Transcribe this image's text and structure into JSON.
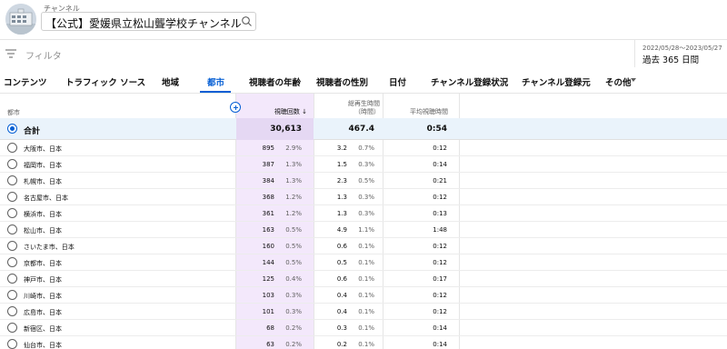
{
  "header": {
    "channel_label": "チャンネル",
    "channel_name": "【公式】愛媛県立松山聾学校チャンネル"
  },
  "filter": {
    "label": "フィルタ"
  },
  "date": {
    "range": "2022/05/28～2023/05/27",
    "period": "過去 365 日間"
  },
  "tabs": [
    {
      "label": "コンテンツ"
    },
    {
      "label": "トラフィック ソース"
    },
    {
      "label": "地域"
    },
    {
      "label": "都市"
    },
    {
      "label": "視聴者の年齢"
    },
    {
      "label": "視聴者の性別"
    },
    {
      "label": "日付"
    },
    {
      "label": "チャンネル登録状況"
    },
    {
      "label": "チャンネル登録元"
    },
    {
      "label": "その他"
    }
  ],
  "active_tab": "都市",
  "colors": {
    "accent": "#065fd4",
    "highlight_column": "#f3e8fb",
    "total_row": "#eaf3fb"
  },
  "table": {
    "headers": {
      "city": "都市",
      "views": "視聴回数 ↓",
      "watch_line1": "総再生時間",
      "watch_line2": "（時間）",
      "avg": "平均視聴時間"
    },
    "total": {
      "label": "合計",
      "views": "30,613",
      "watch": "467.4",
      "avg": "0:54"
    },
    "rows": [
      {
        "name": "大阪市、日本",
        "views": "895",
        "vpct": "2.9%",
        "watch": "3.2",
        "wpct": "0.7%",
        "avg": "0:12"
      },
      {
        "name": "福岡市、日本",
        "views": "387",
        "vpct": "1.3%",
        "watch": "1.5",
        "wpct": "0.3%",
        "avg": "0:14"
      },
      {
        "name": "札幌市、日本",
        "views": "384",
        "vpct": "1.3%",
        "watch": "2.3",
        "wpct": "0.5%",
        "avg": "0:21"
      },
      {
        "name": "名古屋市、日本",
        "views": "368",
        "vpct": "1.2%",
        "watch": "1.3",
        "wpct": "0.3%",
        "avg": "0:12"
      },
      {
        "name": "横浜市、日本",
        "views": "361",
        "vpct": "1.2%",
        "watch": "1.3",
        "wpct": "0.3%",
        "avg": "0:13"
      },
      {
        "name": "松山市、日本",
        "views": "163",
        "vpct": "0.5%",
        "watch": "4.9",
        "wpct": "1.1%",
        "avg": "1:48"
      },
      {
        "name": "さいたま市、日本",
        "views": "160",
        "vpct": "0.5%",
        "watch": "0.6",
        "wpct": "0.1%",
        "avg": "0:12"
      },
      {
        "name": "京都市、日本",
        "views": "144",
        "vpct": "0.5%",
        "watch": "0.5",
        "wpct": "0.1%",
        "avg": "0:12"
      },
      {
        "name": "神戸市、日本",
        "views": "125",
        "vpct": "0.4%",
        "watch": "0.6",
        "wpct": "0.1%",
        "avg": "0:17"
      },
      {
        "name": "川崎市、日本",
        "views": "103",
        "vpct": "0.3%",
        "watch": "0.4",
        "wpct": "0.1%",
        "avg": "0:12"
      },
      {
        "name": "広島市、日本",
        "views": "101",
        "vpct": "0.3%",
        "watch": "0.4",
        "wpct": "0.1%",
        "avg": "0:12"
      },
      {
        "name": "新宿区、日本",
        "views": "68",
        "vpct": "0.2%",
        "watch": "0.3",
        "wpct": "0.1%",
        "avg": "0:14"
      },
      {
        "name": "仙台市、日本",
        "views": "63",
        "vpct": "0.2%",
        "watch": "0.2",
        "wpct": "0.1%",
        "avg": "0:14"
      }
    ]
  }
}
